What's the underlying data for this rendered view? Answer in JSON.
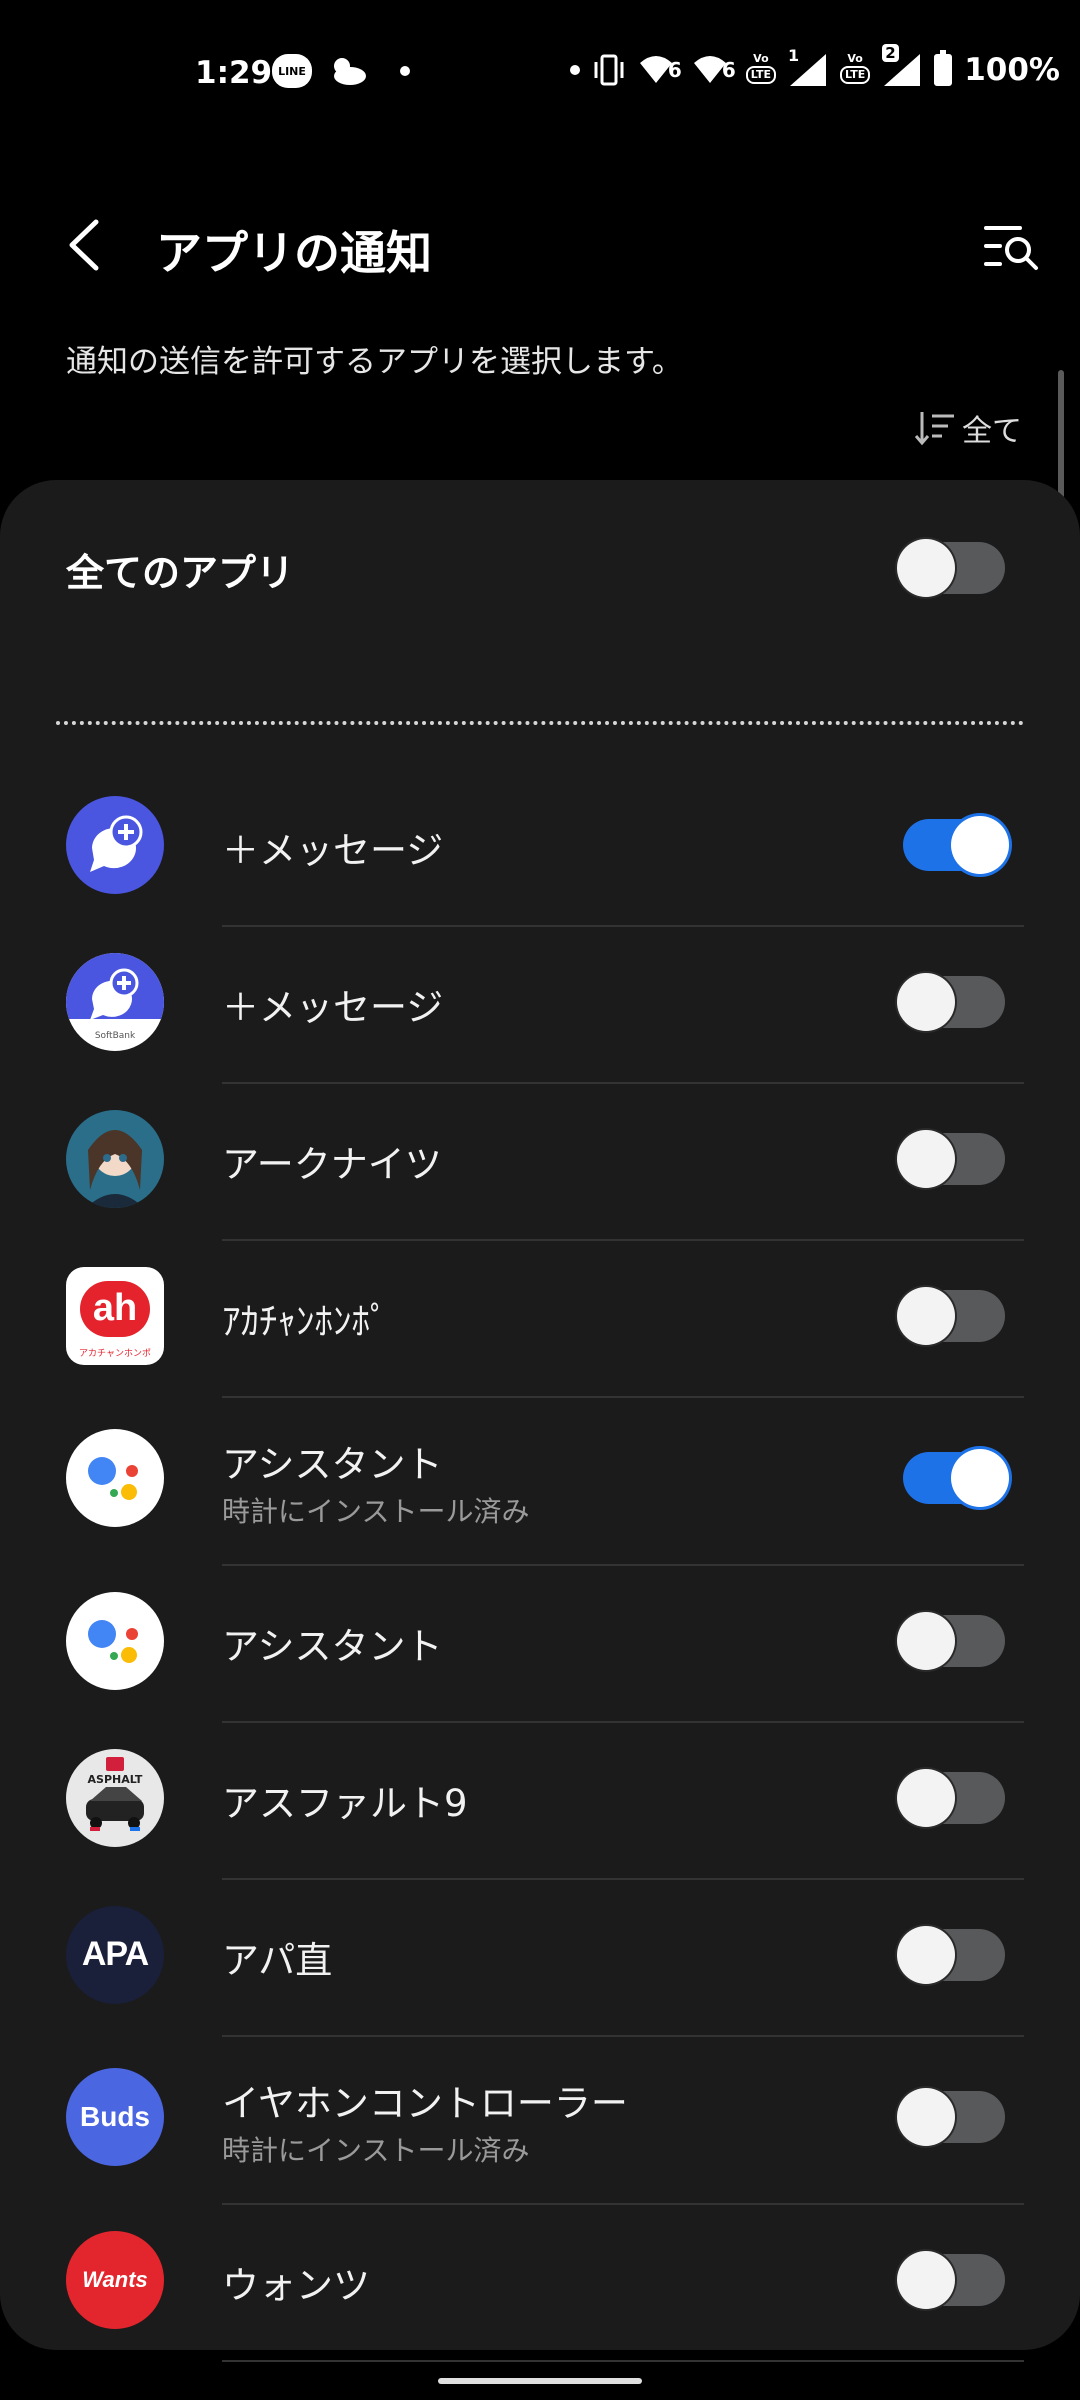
{
  "status_bar": {
    "time": "1:29",
    "line_badge": "LINE",
    "net1": "6",
    "net2": "6",
    "lte1": "LTE",
    "lte2": "LTE",
    "sim1": "1",
    "sim2": "2",
    "battery": "100%"
  },
  "header": {
    "title": "アプリの通知",
    "subtitle": "通知の送信を許可するアプリを選択します。",
    "sort_label": "全て"
  },
  "all_apps": {
    "label": "全てのアプリ",
    "enabled": false
  },
  "apps": [
    {
      "name": "＋メッセージ",
      "subtitle": "",
      "enabled": true,
      "icon": "plus-message-icon"
    },
    {
      "name": "＋メッセージ",
      "subtitle": "",
      "enabled": false,
      "icon": "plus-message-softbank-icon",
      "icon_caption": "SoftBank"
    },
    {
      "name": "アークナイツ",
      "subtitle": "",
      "enabled": false,
      "icon": "arknights-icon"
    },
    {
      "name": "ｱｶﾁｬﾝﾎﾝﾎﾟ",
      "subtitle": "",
      "enabled": false,
      "icon": "akachan-honpo-icon",
      "icon_text": "ah",
      "icon_caption": "アカチャンホンポ"
    },
    {
      "name": "アシスタント",
      "subtitle": "時計にインストール済み",
      "enabled": true,
      "icon": "assistant-icon"
    },
    {
      "name": "アシスタント",
      "subtitle": "",
      "enabled": false,
      "icon": "assistant-icon"
    },
    {
      "name": "アスファルト9",
      "subtitle": "",
      "enabled": false,
      "icon": "asphalt9-icon",
      "icon_text": "ASPHALT"
    },
    {
      "name": "アパ直",
      "subtitle": "",
      "enabled": false,
      "icon": "apa-icon",
      "icon_text": "APA"
    },
    {
      "name": "イヤホンコントローラー",
      "subtitle": "時計にインストール済み",
      "enabled": false,
      "icon": "buds-icon",
      "icon_text": "Buds"
    },
    {
      "name": "ウォンツ",
      "subtitle": "",
      "enabled": false,
      "icon": "wants-icon",
      "icon_text": "Wants"
    }
  ],
  "colors": {
    "toggle_on": "#1d72e8",
    "toggle_off": "#58595b",
    "card": "#1b1b1b"
  }
}
